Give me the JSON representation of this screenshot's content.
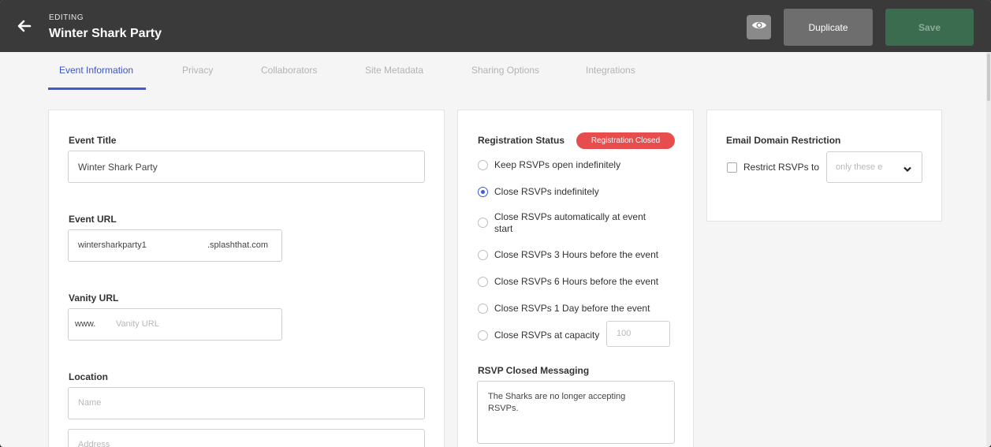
{
  "header": {
    "editing_label": "EDITING",
    "event_name": "Winter Shark Party",
    "duplicate_label": "Duplicate",
    "save_label": "Save"
  },
  "tabs": [
    {
      "label": "Event Information",
      "active": true
    },
    {
      "label": "Privacy",
      "active": false
    },
    {
      "label": "Collaborators",
      "active": false
    },
    {
      "label": "Site Metadata",
      "active": false
    },
    {
      "label": "Sharing Options",
      "active": false
    },
    {
      "label": "Integrations",
      "active": false
    }
  ],
  "event_info": {
    "title_label": "Event Title",
    "title_value": "Winter Shark Party",
    "url_label": "Event URL",
    "url_value": "wintersharkparty1",
    "url_suffix": ".splashthat.com",
    "vanity_label": "Vanity URL",
    "vanity_prefix": "www.",
    "vanity_placeholder": "Vanity URL",
    "location_label": "Location",
    "location_name_placeholder": "Name",
    "location_address_placeholder": "Address"
  },
  "registration": {
    "status_label": "Registration Status",
    "status_badge": "Registration Closed",
    "options": [
      {
        "label": "Keep RSVPs open indefinitely",
        "checked": false
      },
      {
        "label": "Close RSVPs indefinitely",
        "checked": true
      },
      {
        "label": "Close RSVPs automatically at event",
        "label2": "start",
        "checked": false
      },
      {
        "label": "Close RSVPs 3 Hours before the event",
        "checked": false
      },
      {
        "label": "Close RSVPs 6 Hours before the event",
        "checked": false
      },
      {
        "label": "Close RSVPs 1 Day before the event",
        "checked": false
      },
      {
        "label": "Close RSVPs at capacity",
        "checked": false
      }
    ],
    "capacity_placeholder": "100",
    "closed_messaging_label": "RSVP Closed Messaging",
    "closed_message_line1": "The Sharks are no longer accepting",
    "closed_message_line2": "RSVPs."
  },
  "email_restriction": {
    "title": "Email Domain Restriction",
    "checkbox_label": "Restrict RSVPs to",
    "select_value": "only these e"
  },
  "colors": {
    "accent": "#3d5bd9",
    "badge_red": "#e84d4d",
    "save_green": "#3b6c50",
    "header_bg": "#3a3a3a"
  }
}
